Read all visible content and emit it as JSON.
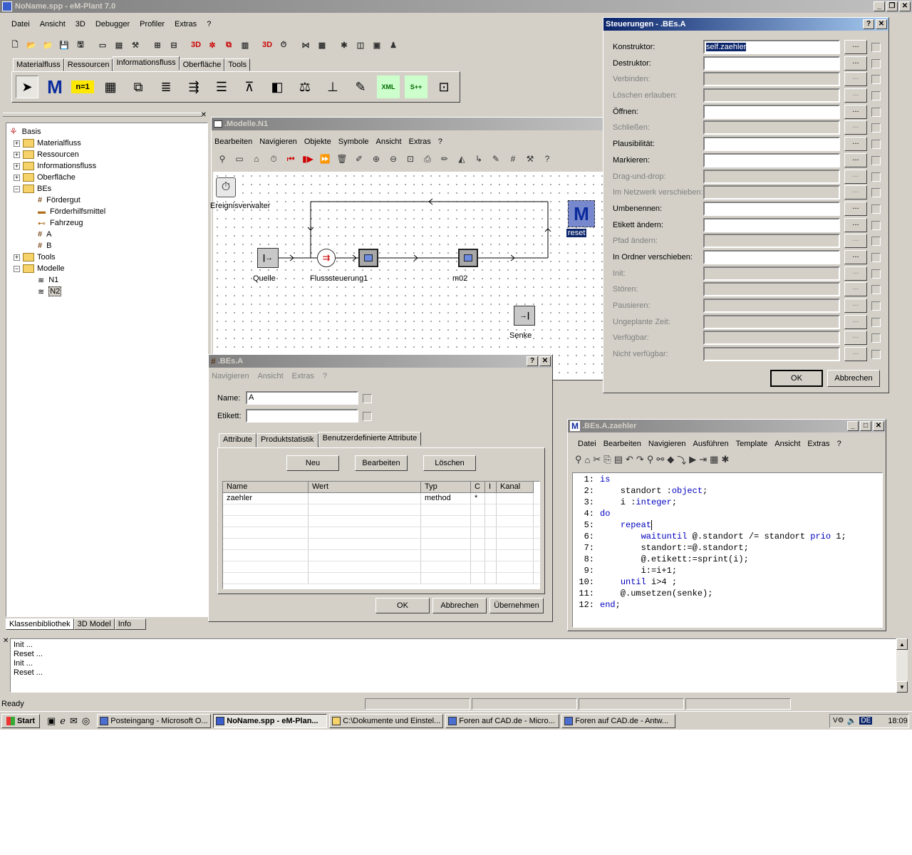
{
  "main_window": {
    "title": "NoName.spp - eM-Plant 7.0",
    "menu": [
      "Datei",
      "Ansicht",
      "3D",
      "Debugger",
      "Profiler",
      "Extras",
      "?"
    ]
  },
  "toolbar_main": {
    "icons": [
      "new-file-icon",
      "open-icon",
      "open-folder-icon",
      "save-icon",
      "save-all-icon",
      "window-icon",
      "window2-icon",
      "tools-icon",
      "layout-icon",
      "layout2-icon",
      "3d-icon",
      "3d-settings-icon",
      "open-3d-icon",
      "chart-icon",
      "3d-log-icon",
      "clock-icon",
      "network-icon",
      "grid-colors-icon",
      "bug-icon",
      "diagram-icon",
      "window3-icon",
      "user-icon"
    ]
  },
  "object_tabs": {
    "tabs": [
      "Materialfluss",
      "Ressourcen",
      "Informationsfluss",
      "Oberfläche",
      "Tools"
    ],
    "active": "Informationsfluss"
  },
  "object_palette": [
    "cursor-icon",
    "method-icon",
    "variable-icon",
    "table-icon",
    "stack-icon",
    "queue-icon",
    "interface-icon",
    "list-icon",
    "trigger-icon",
    "generator-icon",
    "slider-icon",
    "balance-icon",
    "comment-icon",
    "xml-icon",
    "socket-icon",
    "display-icon"
  ],
  "object_palette_labels": {
    "variable": "n=1",
    "method": "M",
    "xml": "XML",
    "socket": "S++",
    "xml_sub": "S++"
  },
  "tree": {
    "items": [
      {
        "label": "Basis",
        "level": 0,
        "type": "root"
      },
      {
        "label": "Materialfluss",
        "level": 1,
        "type": "folder"
      },
      {
        "label": "Ressourcen",
        "level": 1,
        "type": "folder"
      },
      {
        "label": "Informationsfluss",
        "level": 1,
        "type": "folder"
      },
      {
        "label": "Oberfläche",
        "level": 1,
        "type": "folder"
      },
      {
        "label": "BEs",
        "level": 1,
        "type": "folder"
      },
      {
        "label": "Fördergut",
        "level": 2,
        "type": "grid"
      },
      {
        "label": "Förderhilfsmittel",
        "level": 2,
        "type": "pallet"
      },
      {
        "label": "Fahrzeug",
        "level": 2,
        "type": "vehicle"
      },
      {
        "label": "A",
        "level": 2,
        "type": "grid"
      },
      {
        "label": "B",
        "level": 2,
        "type": "grid"
      },
      {
        "label": "Tools",
        "level": 1,
        "type": "folder"
      },
      {
        "label": "Modelle",
        "level": 1,
        "type": "folder"
      },
      {
        "label": "N1",
        "level": 2,
        "type": "model"
      },
      {
        "label": "N2",
        "level": 2,
        "type": "model",
        "selected": true
      }
    ],
    "tabs": [
      "Klassenbibliothek",
      "3D Model",
      "Info"
    ]
  },
  "model_window": {
    "title": ".Modelle.N1",
    "menu": [
      "Bearbeiten",
      "Navigieren",
      "Objekte",
      "Symbole",
      "Ansicht",
      "Extras",
      "?"
    ],
    "objects": {
      "event": "Ereignisverwalter",
      "source": "Quelle",
      "flow": "Flusssteuerung1",
      "m02": "m02",
      "sink": "Senke",
      "reset": "reset"
    }
  },
  "bes_dialog": {
    "title": ".BEs.A",
    "menu": [
      "Navigieren",
      "Ansicht",
      "Extras",
      "?"
    ],
    "name_label": "Name:",
    "name_value": "A",
    "etikett_label": "Etikett:",
    "etikett_value": "",
    "tabs": [
      "Attribute",
      "Produktstatistik",
      "Benutzerdefinierte Attribute"
    ],
    "active_tab": "Benutzerdefinierte Attribute",
    "buttons": {
      "new": "Neu",
      "edit": "Bearbeiten",
      "delete": "Löschen",
      "ok": "OK",
      "cancel": "Abbrechen",
      "apply": "Übernehmen"
    },
    "columns": [
      "Name",
      "Wert",
      "Typ",
      "C",
      "I",
      "Kanal"
    ],
    "rows": [
      [
        "zaehler",
        "",
        "method",
        "*",
        "",
        ""
      ]
    ]
  },
  "controls_dialog": {
    "title": "Steuerungen - .BEs.A",
    "rows": [
      {
        "label": "Konstruktor:",
        "value": "self.zaehler",
        "enabled": true,
        "selected": true
      },
      {
        "label": "Destruktor:",
        "value": "",
        "enabled": true
      },
      {
        "label": "Verbinden:",
        "value": "",
        "enabled": false
      },
      {
        "label": "Löschen erlauben:",
        "value": "",
        "enabled": false
      },
      {
        "label": "Öffnen:",
        "value": "",
        "enabled": true
      },
      {
        "label": "Schließen:",
        "value": "",
        "enabled": false
      },
      {
        "label": "Plausibilität:",
        "value": "",
        "enabled": true
      },
      {
        "label": "Markieren:",
        "value": "",
        "enabled": true
      },
      {
        "label": "Drag-und-drop:",
        "value": "",
        "enabled": false
      },
      {
        "label": "Im Netzwerk verschieben:",
        "value": "",
        "enabled": false
      },
      {
        "label": "Umbenennen:",
        "value": "",
        "enabled": true
      },
      {
        "label": "Etikett ändern:",
        "value": "",
        "enabled": true
      },
      {
        "label": "Pfad ändern:",
        "value": "",
        "enabled": false
      },
      {
        "label": "In Ordner verschieben:",
        "value": "",
        "enabled": true
      },
      {
        "label": "Init:",
        "value": "",
        "enabled": false
      },
      {
        "label": "Stören:",
        "value": "",
        "enabled": false
      },
      {
        "label": "Pausieren:",
        "value": "",
        "enabled": false
      },
      {
        "label": "Ungeplante Zeit:",
        "value": "",
        "enabled": false
      },
      {
        "label": "Verfügbar:",
        "value": "",
        "enabled": false
      },
      {
        "label": "Nicht verfügbar:",
        "value": "",
        "enabled": false
      }
    ],
    "browse": "...",
    "ok": "OK",
    "cancel": "Abbrechen"
  },
  "editor": {
    "title": ".BEs.A.zaehler",
    "menu": [
      "Datei",
      "Bearbeiten",
      "Navigieren",
      "Ausführen",
      "Template",
      "Ansicht",
      "Extras",
      "?"
    ],
    "lines": [
      {
        "n": "1:",
        "parts": [
          {
            "t": "is",
            "k": 1
          }
        ]
      },
      {
        "n": "2:",
        "parts": [
          {
            "t": "    standort :",
            "k": 0
          },
          {
            "t": "object",
            "k": 1
          },
          {
            "t": ";",
            "k": 0
          }
        ]
      },
      {
        "n": "3:",
        "parts": [
          {
            "t": "    i :",
            "k": 0
          },
          {
            "t": "integer",
            "k": 1
          },
          {
            "t": ";",
            "k": 0
          }
        ]
      },
      {
        "n": "4:",
        "parts": [
          {
            "t": "do",
            "k": 1
          }
        ]
      },
      {
        "n": "5:",
        "parts": [
          {
            "t": "    ",
            "k": 0
          },
          {
            "t": "repeat",
            "k": 1
          }
        ]
      },
      {
        "n": "6:",
        "parts": [
          {
            "t": "        ",
            "k": 0
          },
          {
            "t": "waituntil",
            "k": 1
          },
          {
            "t": " @.standort /= standort ",
            "k": 0
          },
          {
            "t": "prio",
            "k": 1
          },
          {
            "t": " 1;",
            "k": 0
          }
        ]
      },
      {
        "n": "7:",
        "parts": [
          {
            "t": "        standort:=@.standort;",
            "k": 0
          }
        ]
      },
      {
        "n": "8:",
        "parts": [
          {
            "t": "        @.etikett:=sprint(i);",
            "k": 0
          }
        ]
      },
      {
        "n": "9:",
        "parts": [
          {
            "t": "        i:=i+1;",
            "k": 0
          }
        ]
      },
      {
        "n": "10:",
        "parts": [
          {
            "t": "    ",
            "k": 0
          },
          {
            "t": "until",
            "k": 1
          },
          {
            "t": " i>4 ;",
            "k": 0
          }
        ]
      },
      {
        "n": "11:",
        "parts": [
          {
            "t": "    @.umsetzen(senke);",
            "k": 0
          }
        ]
      },
      {
        "n": "12:",
        "parts": [
          {
            "t": "end",
            "k": 1
          },
          {
            "t": ";",
            "k": 0
          }
        ]
      }
    ]
  },
  "console": {
    "lines": [
      "Init ...",
      "Reset ...",
      "Init ...",
      "Reset ..."
    ]
  },
  "status": {
    "text": "Ready"
  },
  "taskbar": {
    "start": "Start",
    "tasks": [
      "Posteingang - Microsoft O...",
      "NoName.spp - eM-Plan...",
      "C:\\Dokumente und Einstel...",
      "Foren auf CAD.de - Micro...",
      "Foren auf CAD.de - Antw..."
    ],
    "active_task": 1,
    "clock": "18:09",
    "lang": "DE"
  }
}
